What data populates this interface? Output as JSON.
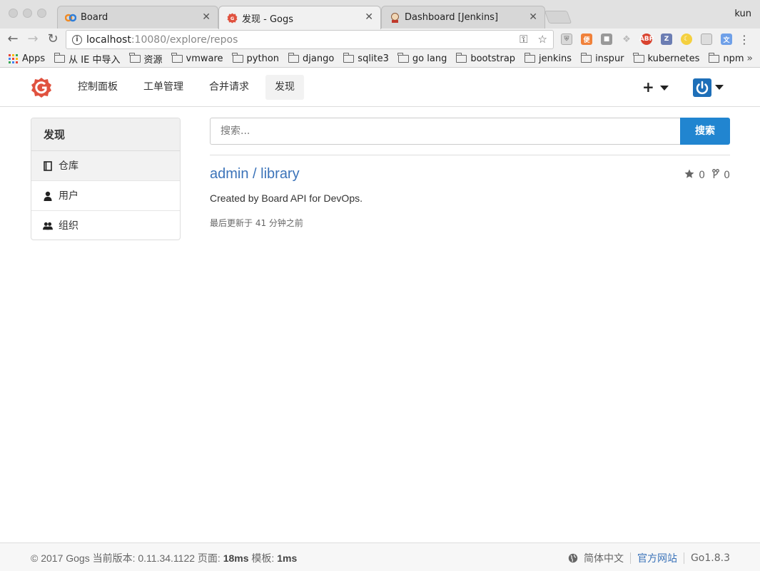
{
  "browser": {
    "tabs": [
      {
        "title": "Board",
        "icon": "board-icon"
      },
      {
        "title": "发现 - Gogs",
        "icon": "gogs-icon"
      },
      {
        "title": "Dashboard [Jenkins]",
        "icon": "jenkins-icon"
      }
    ],
    "profile": "kun",
    "url_host": "localhost",
    "url_rest": ":10080/explore/repos",
    "bookmarks": [
      "Apps",
      "从 IE 中导入",
      "资源",
      "vmware",
      "python",
      "django",
      "sqlite3",
      "go lang",
      "bootstrap",
      "jenkins",
      "inspur",
      "kubernetes",
      "npm"
    ],
    "bookmark_more": "»",
    "extensions": [
      "ext-1",
      "ext-2",
      "ext-3",
      "ext-4",
      "ABP",
      "Z",
      "ext-7",
      "ext-8",
      "ext-9"
    ]
  },
  "header": {
    "nav": [
      "控制面板",
      "工单管理",
      "合并请求",
      "发现"
    ],
    "active_nav": "发现",
    "plus": "+"
  },
  "sidebar": {
    "title": "发现",
    "items": [
      {
        "label": "仓库",
        "icon": "book-icon",
        "active": true
      },
      {
        "label": "用户",
        "icon": "user-icon",
        "active": false
      },
      {
        "label": "组织",
        "icon": "users-icon",
        "active": false
      }
    ]
  },
  "search": {
    "placeholder": "搜索...",
    "button": "搜索"
  },
  "repo": {
    "title": "admin / library",
    "stars": "0",
    "forks": "0",
    "description": "Created by Board API for DevOps.",
    "updated": "最后更新于 41 分钟之前"
  },
  "footer": {
    "copyright": "© 2017 Gogs 当前版本: 0.11.34.1122 页面: ",
    "page_time": "18ms",
    "template_label": " 模板: ",
    "template_time": "1ms",
    "language": "简体中文",
    "official_site": "官方网站",
    "go_version": "Go1.8.3"
  },
  "colors": {
    "accent": "#2185d0",
    "link": "#3b73b9",
    "gogs_brand": "#e0523f"
  }
}
